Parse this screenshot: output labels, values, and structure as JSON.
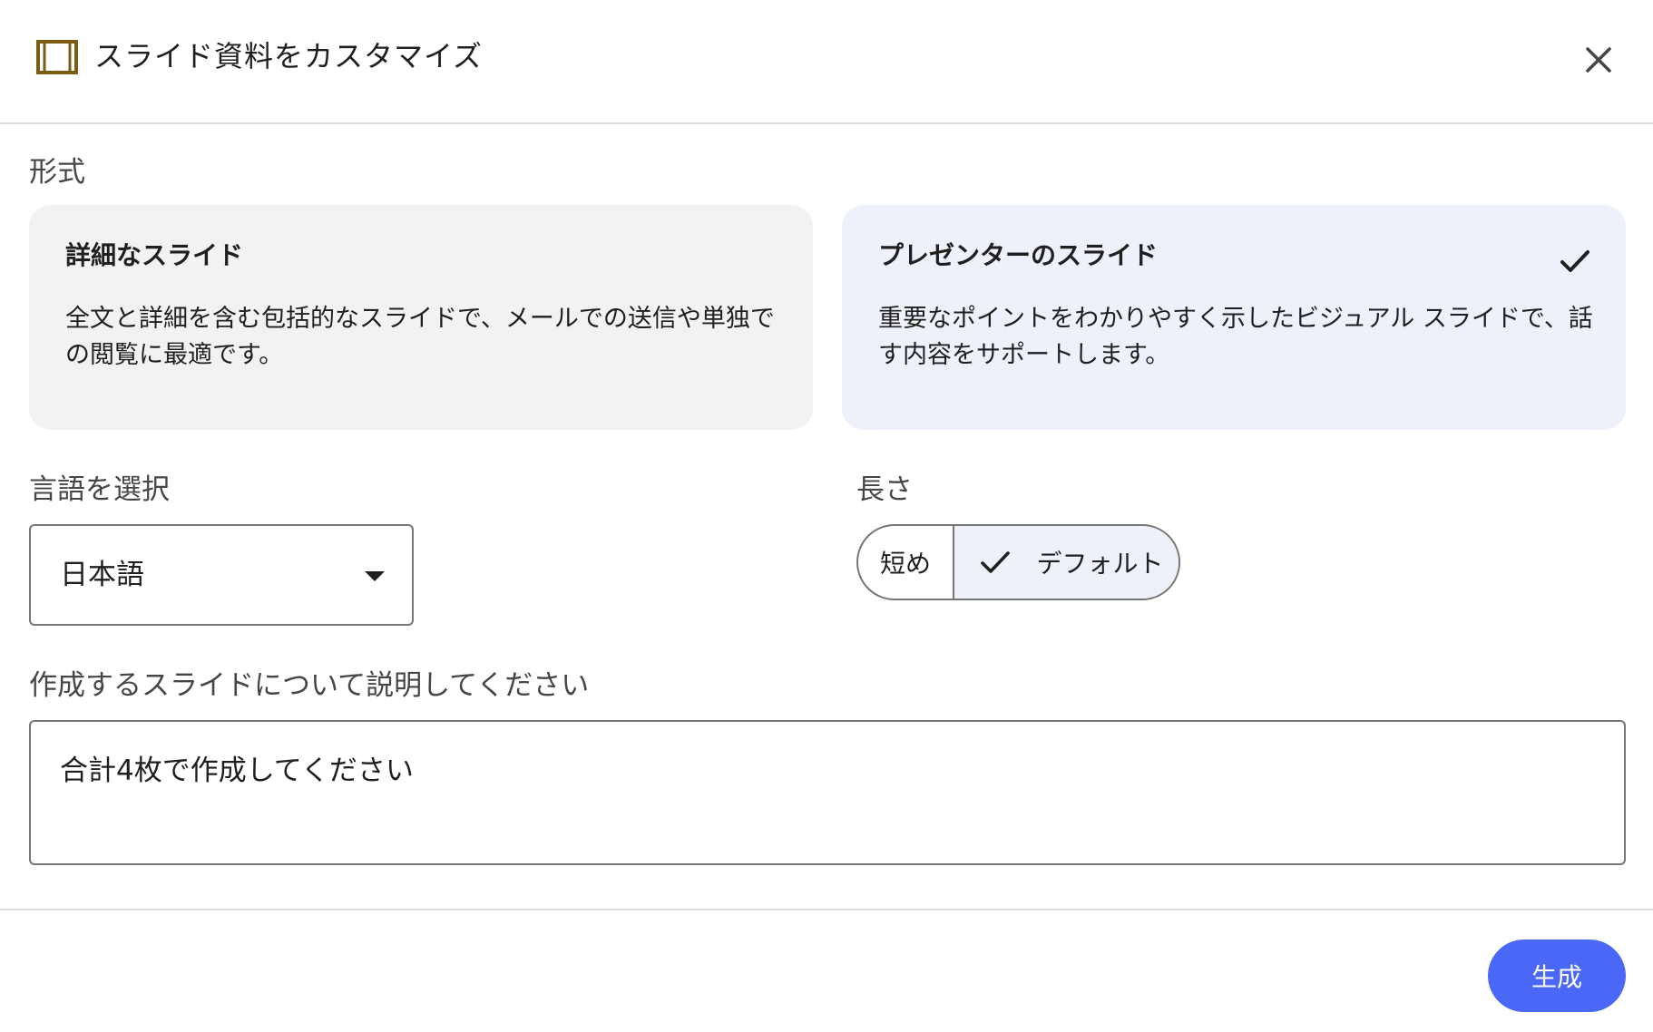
{
  "header": {
    "title": "スライド資料をカスタマイズ",
    "icon": "slides-icon",
    "close_icon": "close-icon"
  },
  "format": {
    "label": "形式",
    "options": [
      {
        "title": "詳細なスライド",
        "description": "全文と詳細を含む包括的なスライドで、メールでの送信や単独での閲覧に最適です。",
        "selected": false
      },
      {
        "title": "プレゼンターのスライド",
        "description": "重要なポイントをわかりやすく示したビジュアル スライドで、話す内容をサポートします。",
        "selected": true
      }
    ]
  },
  "language": {
    "label": "言語を選択",
    "selected": "日本語"
  },
  "length": {
    "label": "長さ",
    "options": [
      {
        "label": "短め",
        "selected": false
      },
      {
        "label": "デフォルト",
        "selected": true
      }
    ]
  },
  "prompt": {
    "label": "作成するスライドについて説明してください",
    "value": "合計4枚で作成してください"
  },
  "actions": {
    "generate_label": "生成"
  },
  "colors": {
    "accent": "#4a67f5",
    "selected_bg": "#eef1f9",
    "card_bg": "#f2f2f2",
    "icon_gold": "#7a5c14"
  }
}
